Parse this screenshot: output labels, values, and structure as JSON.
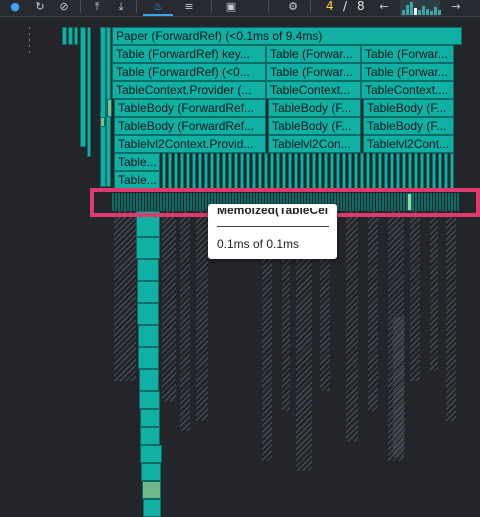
{
  "toolbar": {
    "icons": [
      "record-dot-icon",
      "reload-profile-icon",
      "clear-profile-icon",
      "upload-icon",
      "download-icon",
      "flamegraph-icon",
      "ranked-icon",
      "timeline-icon",
      "settings-icon",
      "previous-commit-icon",
      "next-commit-icon"
    ],
    "commit_current": "4",
    "commit_separator": "/",
    "commit_total": "8",
    "active_color": "#3da5f5",
    "commit_bar_levels": [
      0.35,
      0.8,
      1.0,
      0.55,
      0.4,
      0.7,
      0.45,
      0.3,
      0.6,
      0.4
    ],
    "glyphs": {
      "record": "●",
      "reload": "↻",
      "clear": "⊘",
      "upload": "⤒",
      "download": "⤓",
      "flame": "♨",
      "ranked": "≡",
      "timeline": "▣",
      "settings": "⚙",
      "prev": "←",
      "next": "→"
    }
  },
  "flamegraph": {
    "bar_color": "#10b0a4",
    "rows": [
      [
        "Paper (ForwardRef) (<0.1ms of 9.4ms)"
      ],
      [
        "Table (ForwardRef) key...",
        "Table (Forwar...",
        "Table (Forwar..."
      ],
      [
        "Table (ForwardRef) (<0...",
        "Table (Forwar...",
        "Table (Forwar..."
      ],
      [
        "TableContext.Provider (...",
        "TableContext...",
        "TableContext...."
      ],
      [
        "TableBody (ForwardRef...",
        "TableBody (F...",
        "TableBody (F..."
      ],
      [
        "TableBody (ForwardRef...",
        "TableBody (F...",
        "TableBody (F..."
      ],
      [
        "Tablelvl2Context.Provid...",
        "Tablelvl2Con...",
        "Tablelvl2Cont..."
      ],
      [
        "Table...",
        "",
        ""
      ],
      [
        "Table...",
        "",
        ""
      ]
    ]
  },
  "tooltip": {
    "title": "Memoized(TableCell)",
    "value": "0.1ms of 0.1ms"
  },
  "highlight_color": "#e0396f"
}
